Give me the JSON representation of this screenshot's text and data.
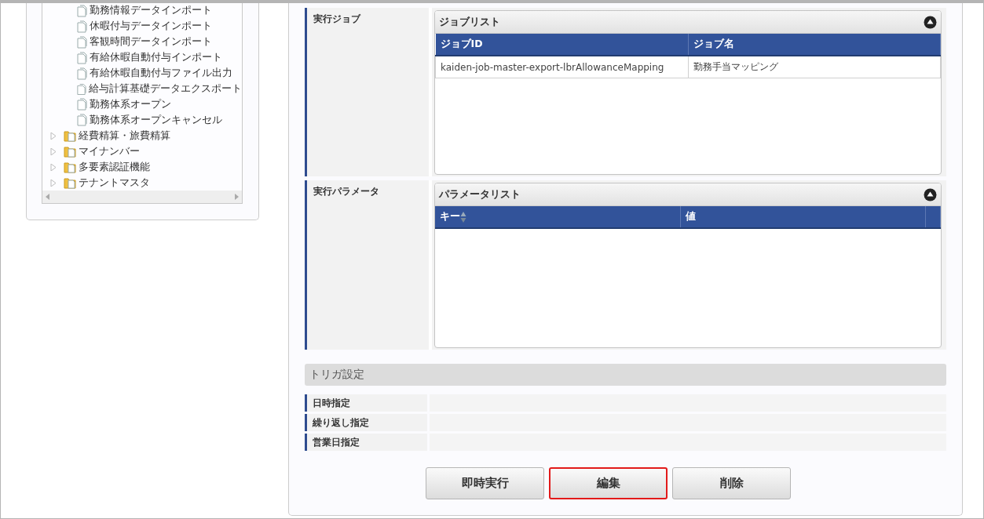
{
  "tree": {
    "branch_leaves": [
      {
        "label": "勤務情報データインポート"
      },
      {
        "label": "休暇付与データインポート"
      },
      {
        "label": "客観時間データインポート"
      },
      {
        "label": "有給休暇自動付与インポート"
      },
      {
        "label": "有給休暇自動付与ファイル出力"
      },
      {
        "label": "給与計算基礎データエクスポート"
      },
      {
        "label": "勤務体系オープン"
      },
      {
        "label": "勤務体系オープンキャンセル"
      }
    ],
    "folders": [
      {
        "label": "経費精算・旅費精算",
        "expanded": false
      },
      {
        "label": "マイナンバー",
        "expanded": false
      },
      {
        "label": "多要素認証機能",
        "expanded": false
      },
      {
        "label": "テナントマスタ",
        "expanded": false
      }
    ]
  },
  "job_section": {
    "label": "実行ジョブ",
    "panel": {
      "title": "ジョブリスト",
      "columns": [
        "ジョブID",
        "ジョブ名"
      ],
      "rows": [
        [
          "kaiden-job-master-export-lbrAllowanceMapping",
          "勤務手当マッピング"
        ]
      ]
    }
  },
  "parameter_section": {
    "label": "実行パラメータ",
    "panel": {
      "title": "パラメータリスト",
      "columns": [
        "キー",
        "値"
      ]
    }
  },
  "trigger": {
    "title": "トリガ設定",
    "rows": [
      {
        "label": "日時指定"
      },
      {
        "label": "繰り返し指定"
      },
      {
        "label": "営業日指定"
      }
    ]
  },
  "buttons": [
    {
      "label": "即時実行",
      "highlighted": false
    },
    {
      "label": "編集",
      "highlighted": true
    },
    {
      "label": "削除",
      "highlighted": false
    }
  ]
}
